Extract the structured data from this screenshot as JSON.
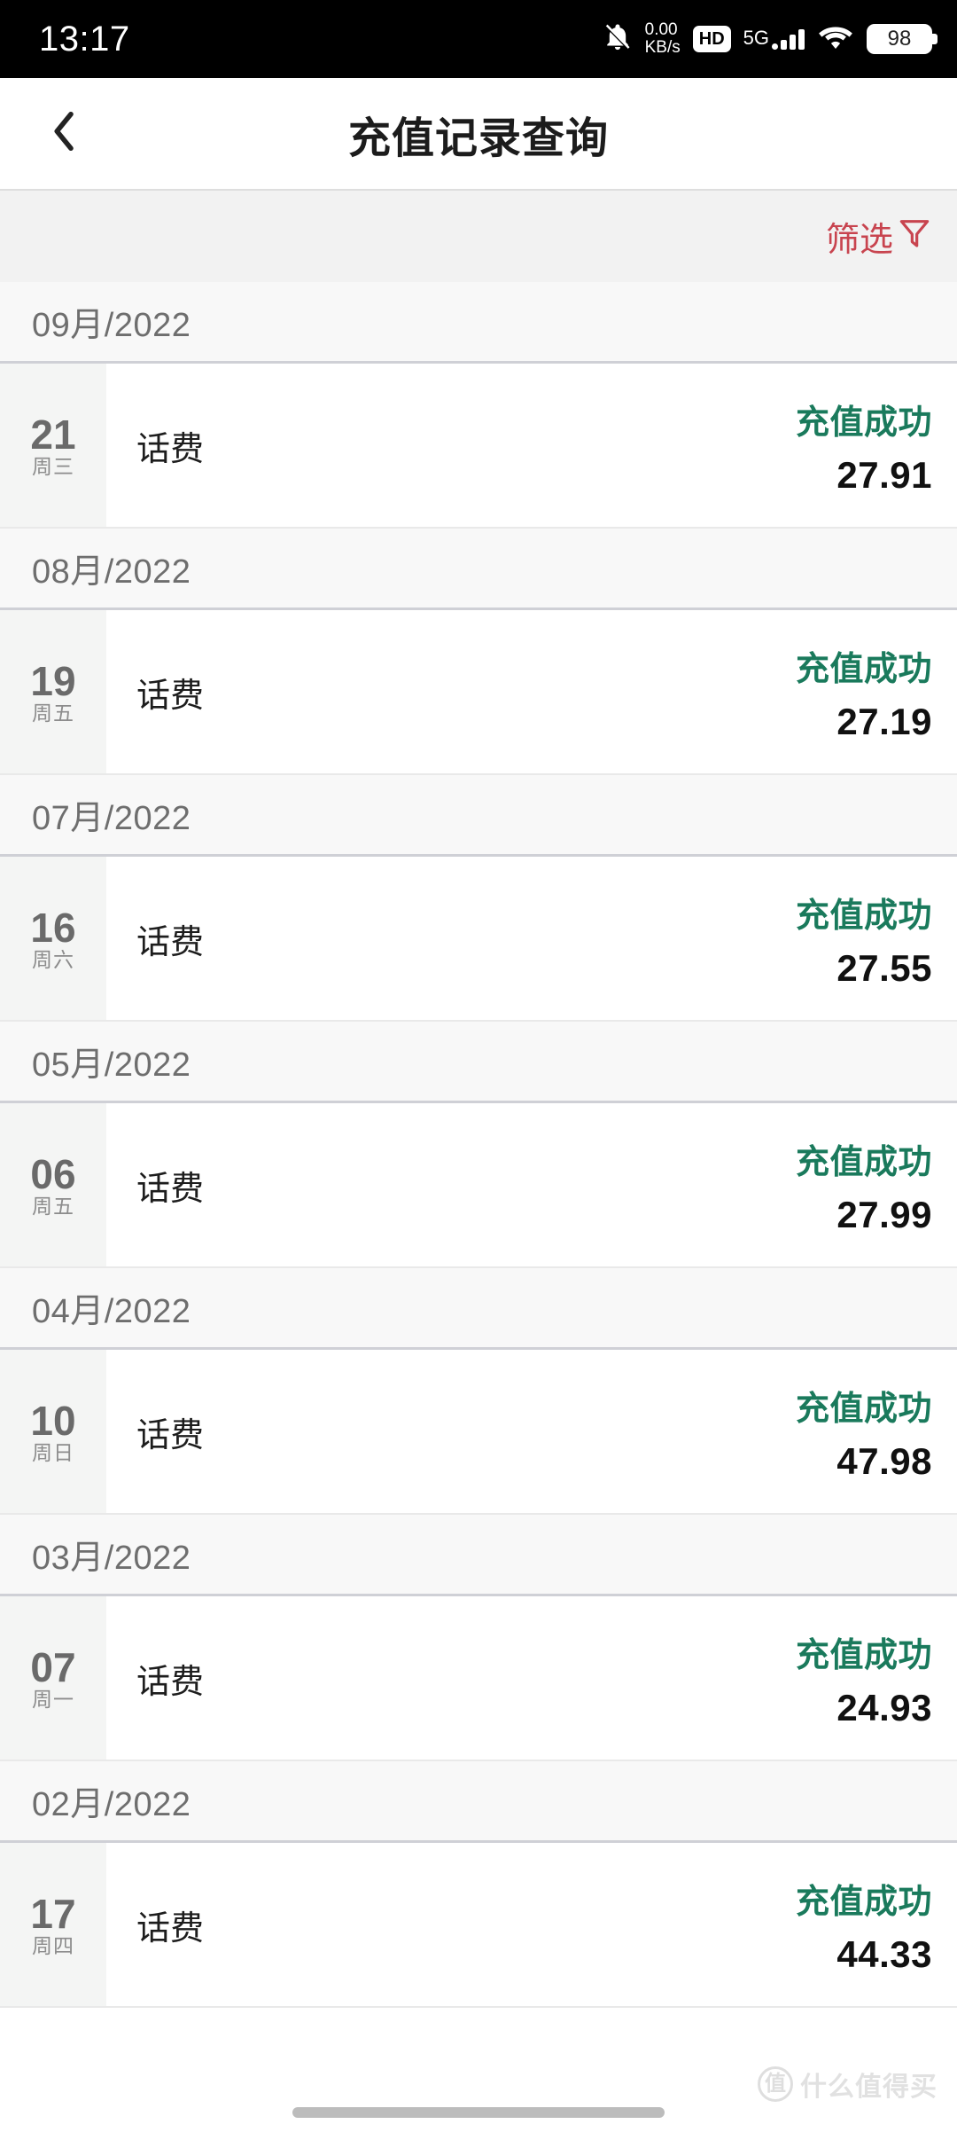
{
  "statusbar": {
    "time": "13:17",
    "netspeed_value": "0.00",
    "netspeed_unit": "KB/s",
    "hd_label": "HD",
    "network_type": "5G",
    "battery_level": "98"
  },
  "navbar": {
    "title": "充值记录查询"
  },
  "filterbar": {
    "filter_label": "筛选",
    "accent_color": "#c8444f"
  },
  "colors": {
    "status_success": "#1a7a5c",
    "amount": "#111111",
    "month_header_text": "#6e6e6e",
    "day_number": "#6a6a6a"
  },
  "list": {
    "sections": [
      {
        "month_label": "09月/2022",
        "rows": [
          {
            "day": "21",
            "weekday": "周三",
            "type": "话费",
            "status": "充值成功",
            "amount": "27.91"
          }
        ]
      },
      {
        "month_label": "08月/2022",
        "rows": [
          {
            "day": "19",
            "weekday": "周五",
            "type": "话费",
            "status": "充值成功",
            "amount": "27.19"
          }
        ]
      },
      {
        "month_label": "07月/2022",
        "rows": [
          {
            "day": "16",
            "weekday": "周六",
            "type": "话费",
            "status": "充值成功",
            "amount": "27.55"
          }
        ]
      },
      {
        "month_label": "05月/2022",
        "rows": [
          {
            "day": "06",
            "weekday": "周五",
            "type": "话费",
            "status": "充值成功",
            "amount": "27.99"
          }
        ]
      },
      {
        "month_label": "04月/2022",
        "rows": [
          {
            "day": "10",
            "weekday": "周日",
            "type": "话费",
            "status": "充值成功",
            "amount": "47.98"
          }
        ]
      },
      {
        "month_label": "03月/2022",
        "rows": [
          {
            "day": "07",
            "weekday": "周一",
            "type": "话费",
            "status": "充值成功",
            "amount": "24.93"
          }
        ]
      },
      {
        "month_label": "02月/2022",
        "rows": [
          {
            "day": "17",
            "weekday": "周四",
            "type": "话费",
            "status": "充值成功",
            "amount": "44.33"
          }
        ]
      }
    ]
  },
  "watermark": {
    "badge": "值",
    "text": "什么值得买"
  }
}
